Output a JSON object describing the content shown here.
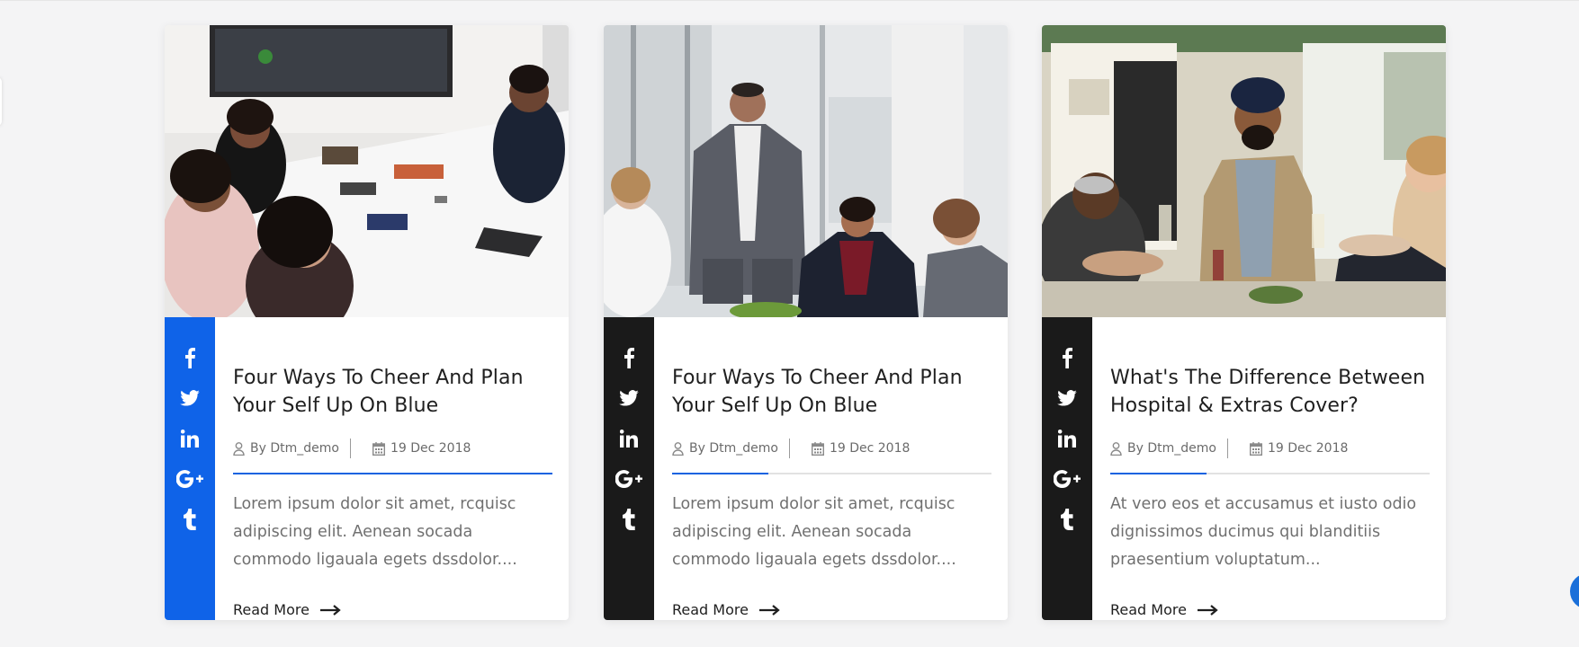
{
  "accent_color": "#1463e0",
  "dark_color": "#1a1a1a",
  "cards": [
    {
      "title": "Four Ways To Cheer And Plan Your Self Up On Blue",
      "author": "By Dtm_demo",
      "date": "19 Dec 2018",
      "excerpt": "Lorem ipsum dolor sit amet, rcquisc adipiscing elit. Aenean socada commodo ligauala egets dssdolor....",
      "read_more": "Read More",
      "share_bar_color": "#0f63e8",
      "divider_progress": 1.0,
      "image_alt": "office meeting photo",
      "share_icons": [
        "facebook-icon",
        "twitter-icon",
        "linkedin-icon",
        "google-plus-icon",
        "tumblr-icon"
      ]
    },
    {
      "title": "Four Ways To Cheer And Plan Your Self Up On Blue",
      "author": "By Dtm_demo",
      "date": "19 Dec 2018",
      "excerpt": "Lorem ipsum dolor sit amet, rcquisc adipiscing elit. Aenean socada commodo ligauala egets dssdolor....",
      "read_more": "Read More",
      "share_bar_color": "#1a1a1a",
      "divider_progress": 0.3,
      "image_alt": "business presentation photo",
      "share_icons": [
        "facebook-icon",
        "twitter-icon",
        "linkedin-icon",
        "google-plus-icon",
        "tumblr-icon"
      ]
    },
    {
      "title": "What's The Difference Between Hospital & Extras Cover?",
      "author": "By Dtm_demo",
      "date": "19 Dec 2018",
      "excerpt": "At vero eos et accusamus et iusto odio dignissimos ducimus qui blanditiis praesentium voluptatum...",
      "read_more": "Read More",
      "share_bar_color": "#1a1a1a",
      "divider_progress": 0.3,
      "image_alt": "celebration toast photo",
      "share_icons": [
        "facebook-icon",
        "twitter-icon",
        "linkedin-icon",
        "google-plus-icon",
        "tumblr-icon"
      ]
    }
  ]
}
